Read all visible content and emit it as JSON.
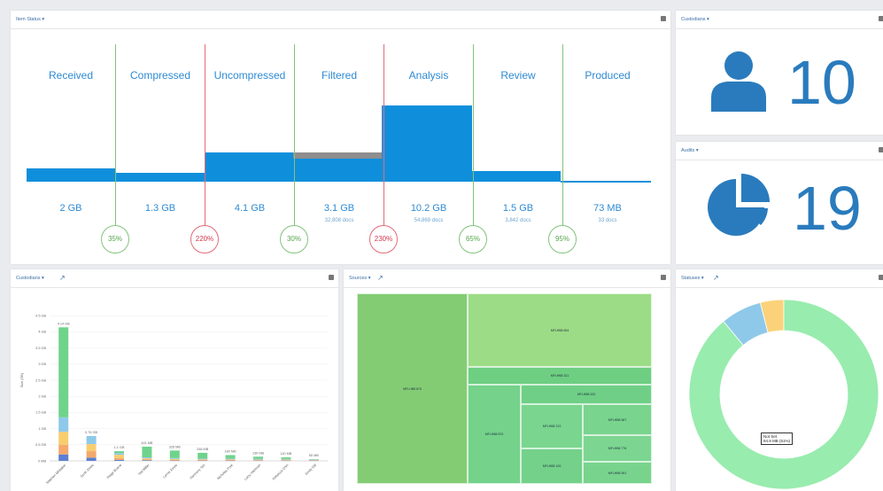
{
  "workflow": {
    "title": "Item Status ▾",
    "stages": [
      {
        "label": "Received",
        "size": "2 GB",
        "docs": ""
      },
      {
        "label": "Compressed",
        "size": "1.3 GB",
        "docs": ""
      },
      {
        "label": "Uncompressed",
        "size": "4.1 GB",
        "docs": ""
      },
      {
        "label": "Filtered",
        "size": "3.1 GB",
        "docs": "32,808 docs"
      },
      {
        "label": "Analysis",
        "size": "10.2 GB",
        "docs": "54,869 docs"
      },
      {
        "label": "Review",
        "size": "1.5 GB",
        "docs": "3,842 docs"
      },
      {
        "label": "Produced",
        "size": "73 MB",
        "docs": "33 docs"
      }
    ],
    "ratios": [
      {
        "value": "35%",
        "status": "good"
      },
      {
        "value": "220%",
        "status": "bad"
      },
      {
        "value": "30%",
        "status": "good"
      },
      {
        "value": "230%",
        "status": "bad"
      },
      {
        "value": "65%",
        "status": "good"
      },
      {
        "value": "95%",
        "status": "good"
      }
    ]
  },
  "custodians_card": {
    "title": "Custodians ▾",
    "count": "10",
    "icon": "user-icon"
  },
  "audits_card": {
    "title": "Audits ▾",
    "count": "19",
    "icon": "pie-chart-icon"
  },
  "custodians_chart": {
    "title": "Custodians ▾",
    "ylabel": "Size (GB)",
    "yticks": [
      "0 MB",
      "0.5 GB",
      "1 GB",
      "1.5 GB",
      "2 GB",
      "2.5 GB",
      "3 GB",
      "3.5 GB",
      "4 GB",
      "4.5 GB"
    ],
    "bar_labels": [
      "4.14 GB",
      "0.76 GB",
      "1.1 GB",
      "441 MB",
      "326 MB",
      "248 MB",
      "180 MB",
      "130 MB",
      "110 MB",
      "50 MB"
    ],
    "categories": [
      "Stephen Whitaker",
      "Scott Jones",
      "Paige Boone",
      "Ted Miller",
      "Lorna Jones",
      "Harmony Tan",
      "Nicholas Frye",
      "Larry Hartman",
      "Rebecca Chin",
      "Emily Gill"
    ]
  },
  "sources_chart": {
    "title": "Sources ▾",
    "tiles": [
      "MFLHB8 876",
      "MFLHB8 654",
      "MFLHB8 321",
      "MFLHB8 432",
      "MFLHB8 213",
      "MFLHB8 567",
      "MFLHB8 109",
      "MFLHB8 876",
      "MFLHB8 776",
      "MFLHB8 991"
    ]
  },
  "statuses_chart": {
    "title": "Statuses ▾",
    "tooltip_line1": "Not Set",
    "tooltip_line2": "94.9 MB (51%)"
  },
  "colors": {
    "accent": "#0f8fdb",
    "good": "#82c37c",
    "bad": "#e36b77"
  },
  "chart_data": [
    {
      "type": "bar",
      "title": "Custodians",
      "ylabel": "Size (GB)",
      "stacked": true,
      "categories": [
        "Stephen Whitaker",
        "Scott Jones",
        "Paige Boone",
        "Ted Miller",
        "Lorna Jones",
        "Harmony Tan",
        "Nicholas Frye",
        "Larry Hartman",
        "Rebecca Chin",
        "Emily Gill"
      ],
      "ylim": [
        0,
        5
      ],
      "series": [
        {
          "color": "#5b7fd0",
          "values": [
            0.2,
            0.1,
            0.03,
            0.02,
            0.01,
            0.01,
            0.01,
            0.01,
            0.01,
            0.01
          ]
        },
        {
          "color": "#f4a86c",
          "values": [
            0.3,
            0.2,
            0.06,
            0.03,
            0.02,
            0.02,
            0.02,
            0.01,
            0.01,
            0.01
          ]
        },
        {
          "color": "#f7cd6e",
          "values": [
            0.4,
            0.22,
            0.1,
            0.03,
            0.03,
            0.02,
            0.02,
            0.02,
            0.02,
            0.01
          ]
        },
        {
          "color": "#8ec9ea",
          "values": [
            0.45,
            0.25,
            0.05,
            0.03,
            0.03,
            0.02,
            0.02,
            0.02,
            0.02,
            0.01
          ]
        },
        {
          "color": "#6fd38c",
          "values": [
            2.79,
            0.0,
            0.06,
            0.33,
            0.23,
            0.18,
            0.11,
            0.07,
            0.05,
            0.01
          ]
        }
      ]
    },
    {
      "type": "pie",
      "title": "Statuses",
      "donut": true,
      "categories": [
        "Not Set",
        "Blue",
        "Yellow"
      ],
      "values": [
        89,
        7,
        4
      ],
      "colors": [
        "#98ecae",
        "#8ec9ea",
        "#fbd27a"
      ]
    }
  ]
}
